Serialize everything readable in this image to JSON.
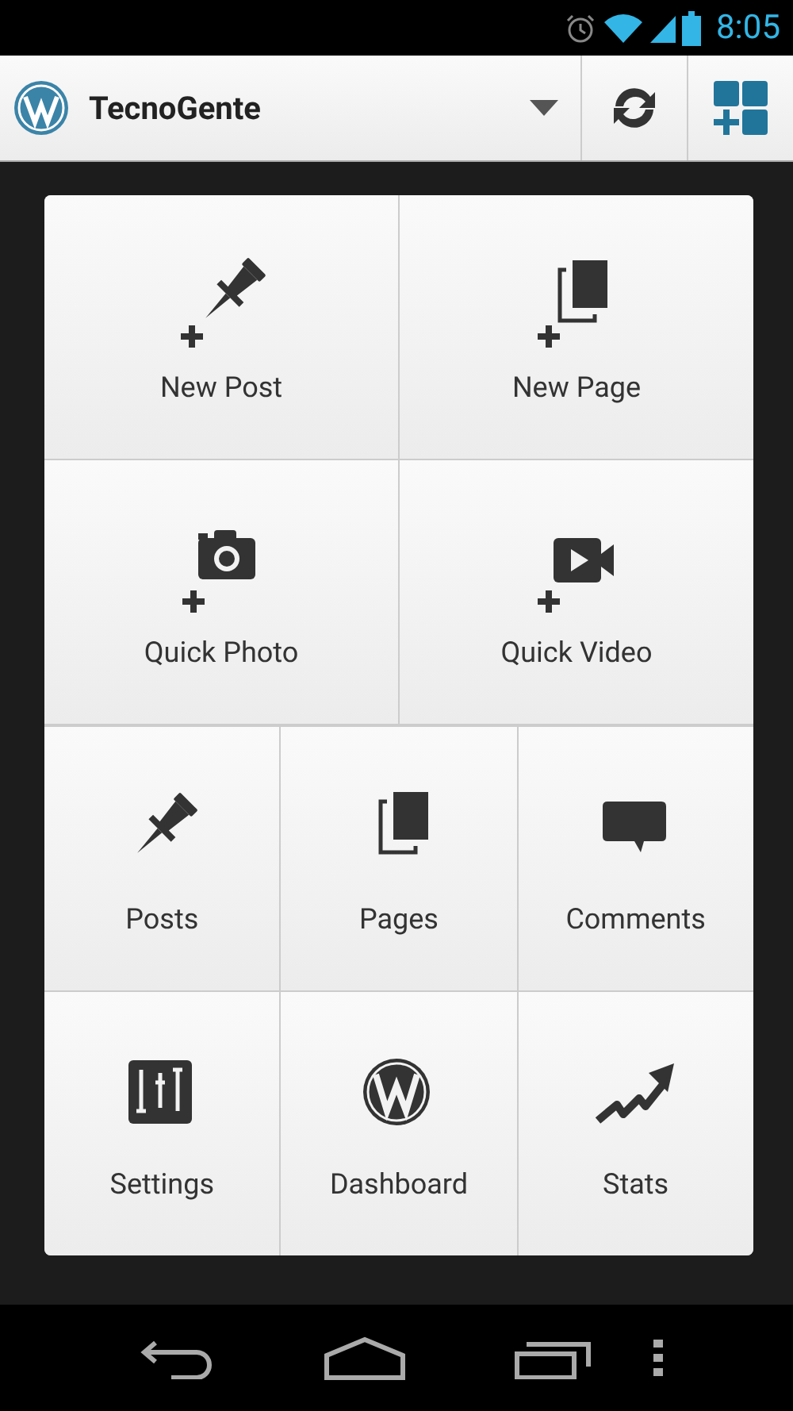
{
  "status_bar": {
    "time": "8:05"
  },
  "action_bar": {
    "site_name": "TecnoGente"
  },
  "quick_actions": [
    {
      "label": "New Post"
    },
    {
      "label": "New Page"
    },
    {
      "label": "Quick Photo"
    },
    {
      "label": "Quick Video"
    }
  ],
  "menu": [
    {
      "label": "Posts"
    },
    {
      "label": "Pages"
    },
    {
      "label": "Comments"
    },
    {
      "label": "Settings"
    },
    {
      "label": "Dashboard"
    },
    {
      "label": "Stats"
    }
  ]
}
